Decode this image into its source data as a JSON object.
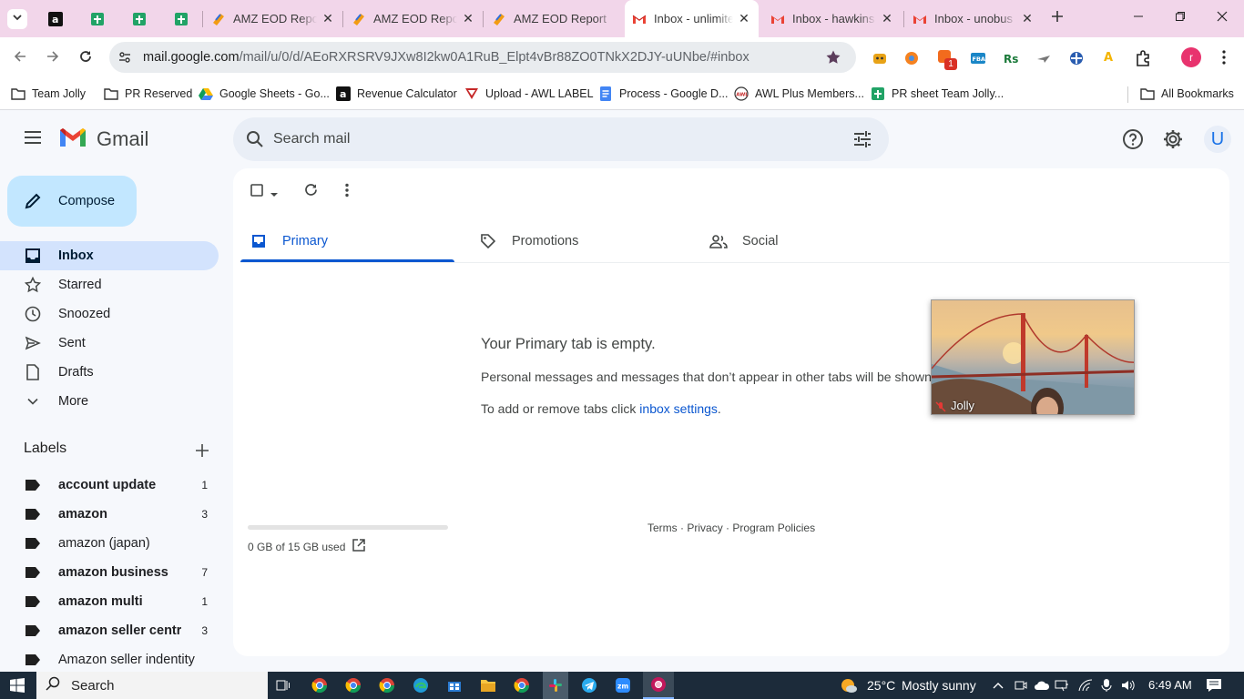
{
  "browser": {
    "tabs": [
      {
        "title": "",
        "favicon": "amazon-favicon"
      },
      {
        "title": "",
        "favicon": "sheets-favicon"
      },
      {
        "title": "",
        "favicon": "sheets-favicon"
      },
      {
        "title": "",
        "favicon": "sheets-favicon"
      },
      {
        "title": "AMZ EOD Report",
        "favicon": "zoho-favicon"
      },
      {
        "title": "AMZ EOD Report",
        "favicon": "zoho-favicon"
      },
      {
        "title": "AMZ EOD Report",
        "favicon": "zoho-favicon"
      },
      {
        "title": "Inbox - unlimited",
        "favicon": "gmail-favicon",
        "active": true
      },
      {
        "title": "Inbox - hawkins",
        "favicon": "gmail-favicon"
      },
      {
        "title": "Inbox - unobus",
        "favicon": "gmail-favicon"
      }
    ],
    "url_host": "mail.google.com",
    "url_path": "/mail/u/0/d/AEoRXRSRV9JXw8I2kw0A1RuB_Elpt4vBr88ZO0TNkX2DJY-uUNbe/#inbox",
    "extension_badge": "1",
    "profile_initial": "r",
    "bookmarks": [
      {
        "label": "Team Jolly",
        "icon": "folder-icon"
      },
      {
        "label": "PR Reserved",
        "icon": "folder-icon"
      },
      {
        "label": "Google Sheets - Go...",
        "icon": "drive-icon"
      },
      {
        "label": "Revenue Calculator",
        "icon": "amazon-icon"
      },
      {
        "label": "Upload - AWL LABEL",
        "icon": "awl-icon"
      },
      {
        "label": "Process - Google D...",
        "icon": "docs-icon"
      },
      {
        "label": "AWL Plus Members...",
        "icon": "awl-plus-icon"
      },
      {
        "label": "PR sheet Team Jolly...",
        "icon": "sheets-icon"
      }
    ],
    "all_bookmarks": "All Bookmarks"
  },
  "gmail": {
    "logo_text": "Gmail",
    "search_placeholder": "Search mail",
    "avatar_initial": "U",
    "compose_label": "Compose",
    "nav": [
      {
        "label": "Inbox",
        "icon": "inbox-icon",
        "active": true
      },
      {
        "label": "Starred",
        "icon": "star-icon"
      },
      {
        "label": "Snoozed",
        "icon": "clock-icon"
      },
      {
        "label": "Sent",
        "icon": "send-icon"
      },
      {
        "label": "Drafts",
        "icon": "draft-icon"
      },
      {
        "label": "More",
        "icon": "chevron-down-icon"
      }
    ],
    "labels_title": "Labels",
    "labels": [
      {
        "name": "account update",
        "count": "1",
        "bold": true
      },
      {
        "name": "amazon",
        "count": "3",
        "bold": true
      },
      {
        "name": "amazon (japan)",
        "count": "",
        "bold": false
      },
      {
        "name": "amazon business",
        "count": "7",
        "bold": true
      },
      {
        "name": "amazon multi",
        "count": "1",
        "bold": true
      },
      {
        "name": "amazon seller centr",
        "count": "3",
        "bold": true
      },
      {
        "name": "Amazon seller indentity",
        "count": "",
        "bold": false
      }
    ],
    "category_tabs": [
      {
        "label": "Primary",
        "icon": "inbox-icon",
        "active": true
      },
      {
        "label": "Promotions",
        "icon": "tag-icon"
      },
      {
        "label": "Social",
        "icon": "people-icon"
      }
    ],
    "empty_title": "Your Primary tab is empty.",
    "empty_desc": "Personal messages and messages that don’t appear in other tabs will be shown here.",
    "empty_hint_prefix": "To add or remove tabs click ",
    "empty_hint_link": "inbox settings",
    "empty_hint_suffix": ".",
    "storage_text": "0 GB of 15 GB used",
    "storage_fraction": 0.0,
    "footer": {
      "terms": "Terms",
      "privacy": "Privacy",
      "policies": "Program Policies",
      "dot": "·"
    }
  },
  "video_overlay": {
    "name": "Jolly"
  },
  "taskbar": {
    "search_label": "Search",
    "weather_temp": "25°C",
    "weather_desc": "Mostly sunny",
    "time": "6:49 AM"
  },
  "colors": {
    "accent": "#0b57d0",
    "gmail_red": "#ea4335",
    "compose_bg": "#c2e7ff",
    "inbox_active": "#d3e3fd"
  }
}
